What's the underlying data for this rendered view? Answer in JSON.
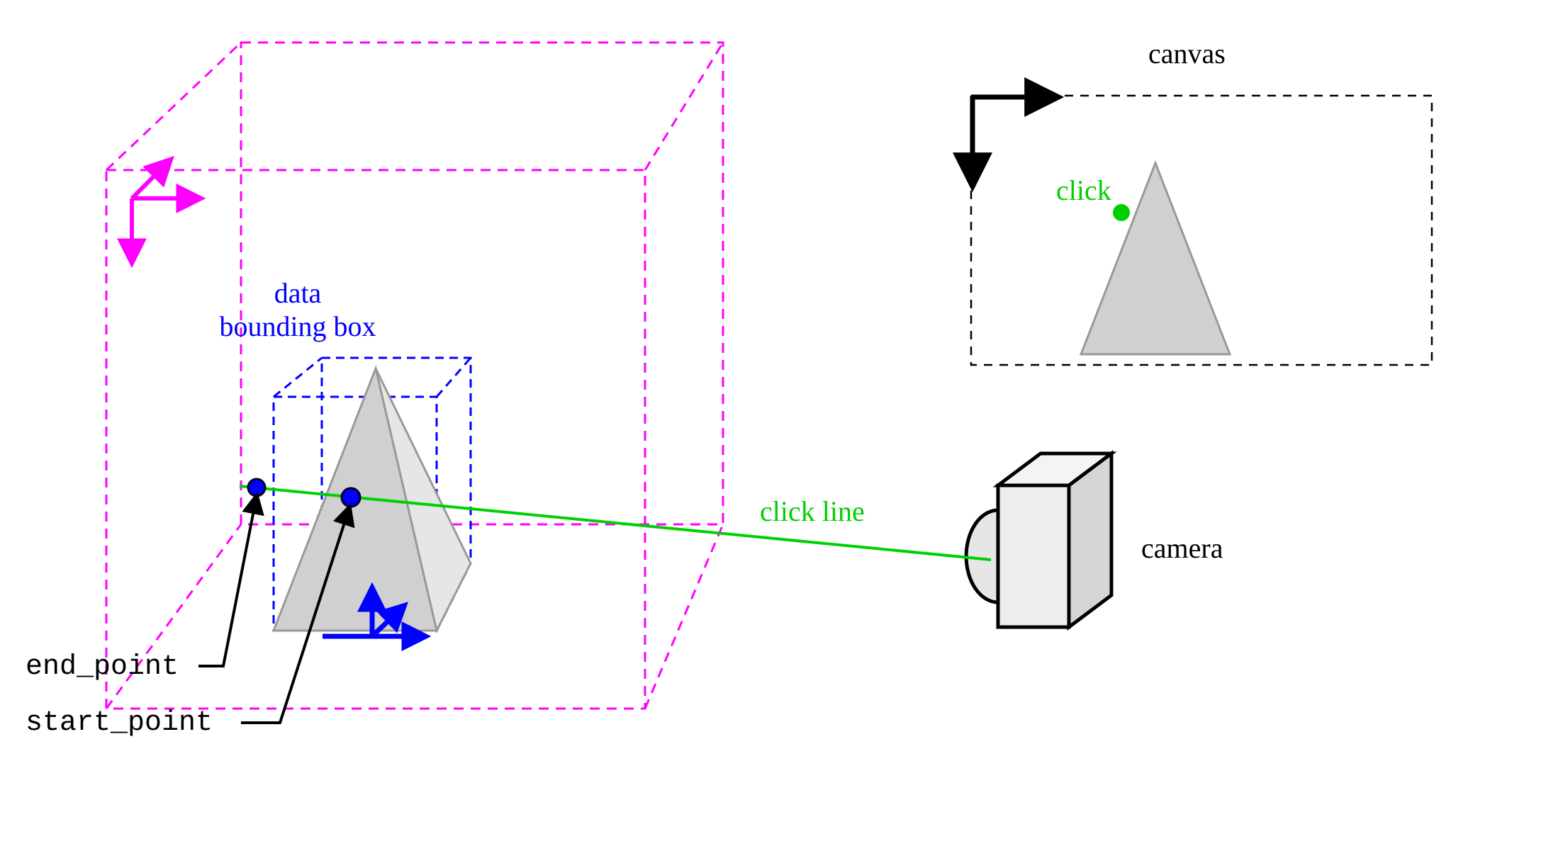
{
  "labels": {
    "bounding_box_line1": "data",
    "bounding_box_line2": "bounding box",
    "end_point": "end_point",
    "start_point": "start_point",
    "click_line": "click line",
    "camera": "camera",
    "canvas": "canvas",
    "click": "click"
  },
  "colors": {
    "outer_cube": "#ff00ff",
    "inner_cube": "#0000ff",
    "click_line": "#00d000",
    "pyramid_fill": "#d8d8d8",
    "pyramid_stroke": "#999999",
    "canvas_axes": "#000000",
    "corner_axes": "#ff00ff",
    "data_origin_axes": "#0000ff"
  },
  "diagram": {
    "description": "A 3D scene showing a camera projecting a click from a 2D canvas into a 3D bounding volume. The click ray intersects the data bounding box at start_point (front) and end_point (back). A pyramid mesh sits inside the blue data bounding box, which is inside a larger magenta cube.",
    "elements": [
      "outer magenta dashed cube (world bounds)",
      "inner blue dashed cube (data bounding box)",
      "gray pyramid mesh inside data bounding box",
      "green click ray from camera through both bounding box faces",
      "two blue intersection points (start_point nearer camera, end_point farther)",
      "camera icon to the right",
      "2D canvas inset upper-right with click point and projected pyramid silhouette"
    ]
  }
}
